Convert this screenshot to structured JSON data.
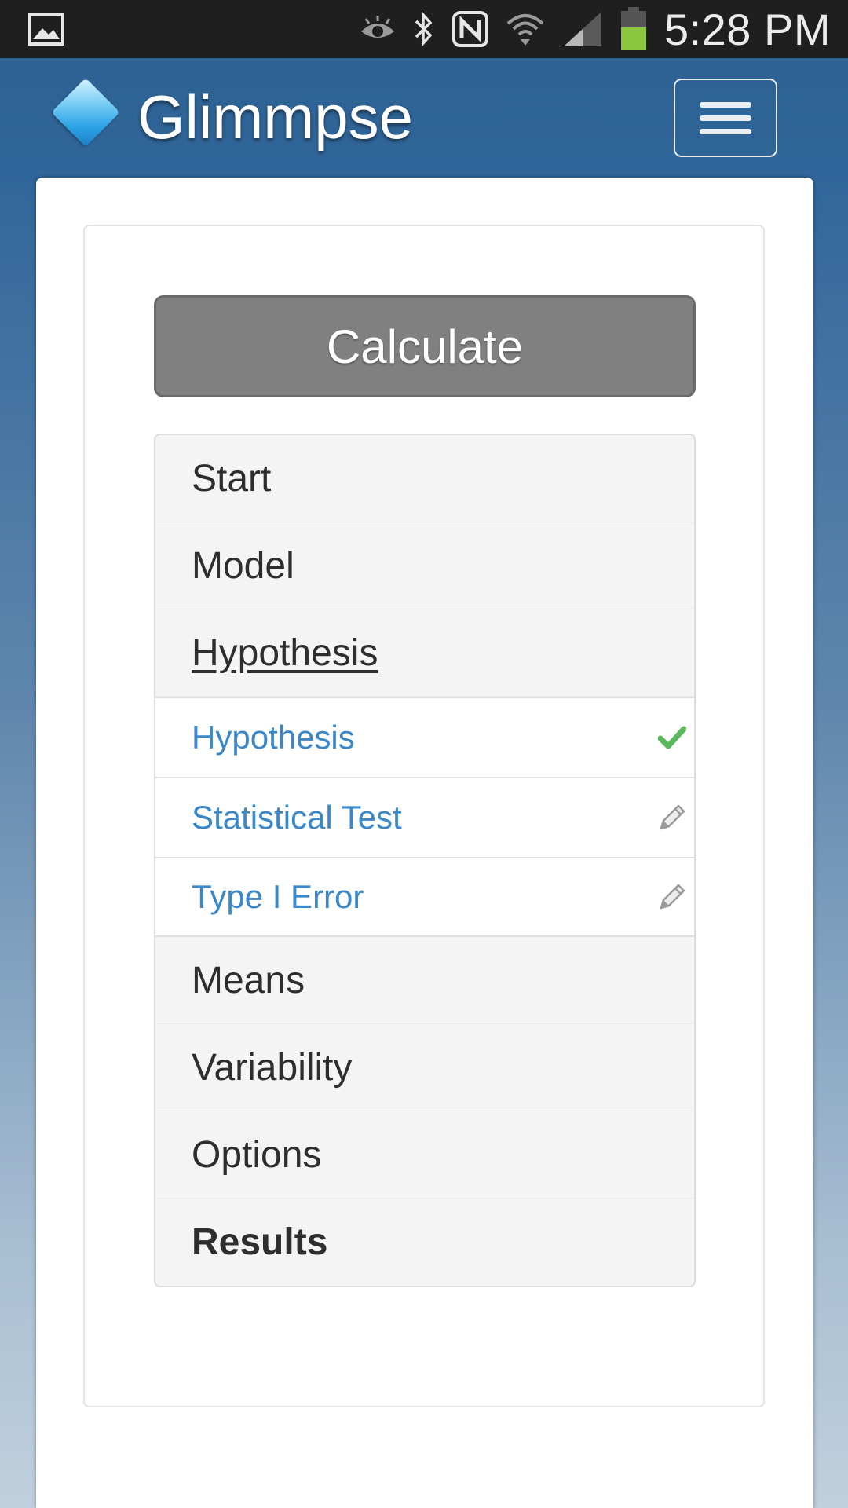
{
  "status_bar": {
    "time": "5:28 PM",
    "icons": [
      "gallery-icon",
      "eye-icon",
      "bluetooth-icon",
      "nfc-icon",
      "wifi-icon",
      "signal-icon",
      "battery-icon"
    ]
  },
  "header": {
    "title": "Glimmpse",
    "logo": "diamond-logo-icon",
    "menu_icon": "hamburger-menu-icon"
  },
  "main": {
    "calculate_label": "Calculate",
    "nav": [
      {
        "label": "Start"
      },
      {
        "label": "Model"
      },
      {
        "label": "Hypothesis",
        "active": true
      },
      {
        "label": "Means"
      },
      {
        "label": "Variability"
      },
      {
        "label": "Options"
      },
      {
        "label": "Results"
      }
    ],
    "subnav": [
      {
        "label": "Hypothesis",
        "status_icon": "checkmark-icon"
      },
      {
        "label": "Statistical Test",
        "status_icon": "pencil-icon"
      },
      {
        "label": "Type I Error",
        "status_icon": "pencil-icon"
      }
    ]
  },
  "colors": {
    "link": "#3b87c7",
    "button": "#808080",
    "check": "#5cb85c"
  }
}
